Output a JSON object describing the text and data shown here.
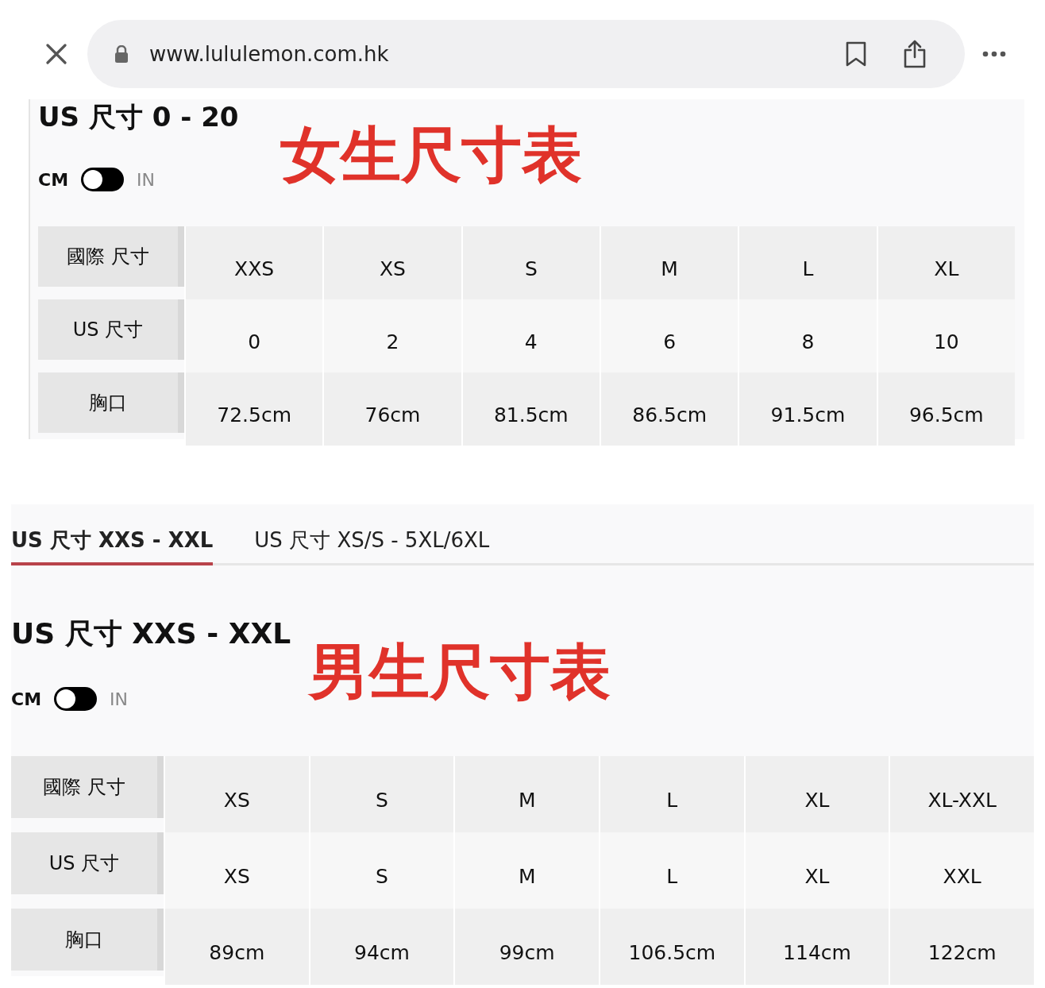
{
  "browser": {
    "url": "www.lululemon.com.hk"
  },
  "sections": [
    {
      "title": "US 尺寸 0 - 20",
      "annotation": "女生尺寸表",
      "toggle": {
        "left_label": "CM",
        "right_label": "IN",
        "on": false
      },
      "table": {
        "rows": [
          {
            "header": "國際 尺寸",
            "cells": [
              "XXS",
              "XS",
              "S",
              "M",
              "L",
              "XL"
            ]
          },
          {
            "header": "US 尺寸",
            "cells": [
              "0",
              "2",
              "4",
              "6",
              "8",
              "10"
            ]
          },
          {
            "header": "胸口",
            "cells": [
              "72.5cm",
              "76cm",
              "81.5cm",
              "86.5cm",
              "91.5cm",
              "96.5cm"
            ]
          }
        ]
      }
    },
    {
      "tabs": [
        {
          "label": "US 尺寸 XXS - XXL",
          "selected": true
        },
        {
          "label": "US 尺寸 XS/S - 5XL/6XL",
          "selected": false
        }
      ],
      "title": "US 尺寸 XXS - XXL",
      "annotation": "男生尺寸表",
      "toggle": {
        "left_label": "CM",
        "right_label": "IN",
        "on": false
      },
      "table": {
        "rows": [
          {
            "header": "國際 尺寸",
            "cells": [
              "XS",
              "S",
              "M",
              "L",
              "XL",
              "XL-XXL"
            ]
          },
          {
            "header": "US 尺寸",
            "cells": [
              "XS",
              "S",
              "M",
              "L",
              "XL",
              "XXL"
            ]
          },
          {
            "header": "胸口",
            "cells": [
              "89cm",
              "94cm",
              "99cm",
              "106.5cm",
              "114cm",
              "122cm"
            ]
          }
        ]
      }
    }
  ]
}
